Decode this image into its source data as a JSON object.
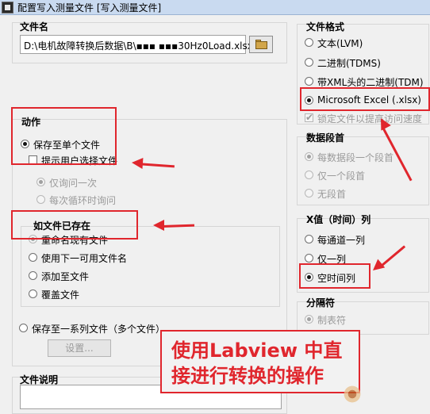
{
  "window": {
    "title": "配置写入测量文件 [写入测量文件]"
  },
  "file_name": {
    "heading": "文件名",
    "path_value": "D:\\电机故障转换后数据\\B\\▪▪▪ ▪▪▪30Hz0Load.xlsx"
  },
  "action": {
    "heading": "动作",
    "save_single": "保存至单个文件",
    "prompt_user": "提示用户选择文件",
    "ask_once": "仅询问一次",
    "ask_each_loop": "每次循环时询问"
  },
  "if_exists": {
    "heading": "如文件已存在",
    "options": [
      "重命名现有文件",
      "使用下一可用文件名",
      "添加至文件",
      "覆盖文件"
    ]
  },
  "save_series": {
    "label": "保存至一系列文件（多个文件）",
    "settings_button": "设置..."
  },
  "file_desc": {
    "heading": "文件说明"
  },
  "file_format": {
    "heading": "文件格式",
    "options": [
      "文本(LVM)",
      "二进制(TDMS)",
      "带XML头的二进制(TDM)",
      "Microsoft Excel (.xlsx)"
    ],
    "lock_option": "锁定文件以提高访问速度"
  },
  "segment": {
    "heading": "数据段首",
    "options": [
      "每数据段一个段首",
      "仅一个段首",
      "无段首"
    ]
  },
  "x_column": {
    "heading": "X值（时间）列",
    "options": [
      "每通道一列",
      "仅一列",
      "空时间列"
    ]
  },
  "separator": {
    "heading": "分隔符",
    "option": "制表符"
  },
  "banner": {
    "text": "使用Labview 中直接进行转换的操作"
  },
  "colors": {
    "annotation_red": "#e0262d",
    "title_bar": "#c9daf0"
  }
}
